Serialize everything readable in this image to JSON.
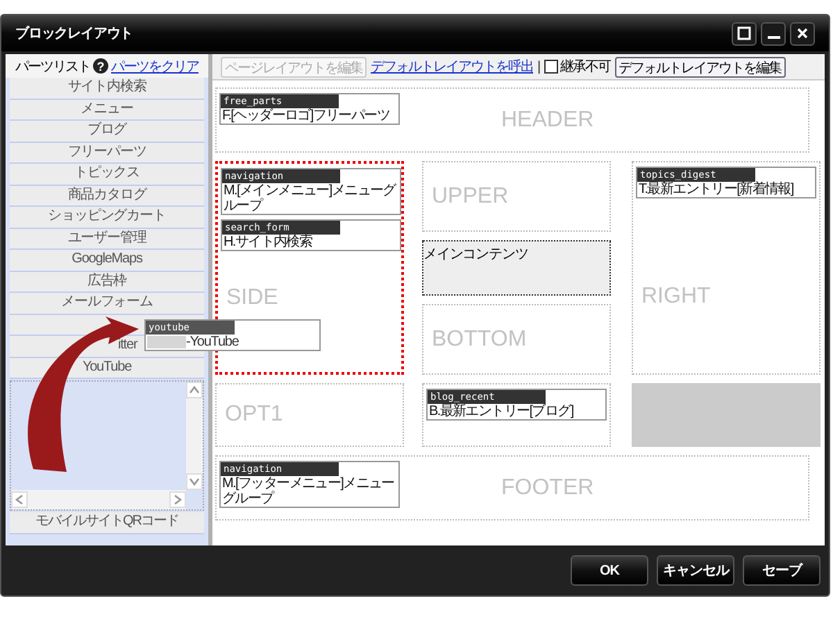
{
  "window": {
    "title": "ブロックレイアウト"
  },
  "title_buttons": [
    {
      "kind": "maximize"
    },
    {
      "kind": "minimize"
    },
    {
      "kind": "close"
    }
  ],
  "sidebar": {
    "title": "パーツリスト",
    "help": "?",
    "clear_link": "パーツをクリア",
    "items": [
      {
        "kind": "part",
        "label": "サイト内検索"
      },
      {
        "kind": "part",
        "label": "メニュー"
      },
      {
        "kind": "part",
        "label": "ブログ"
      },
      {
        "kind": "part",
        "label": "フリーパーツ"
      },
      {
        "kind": "part",
        "label": "トピックス"
      },
      {
        "kind": "part",
        "label": "商品カタログ"
      },
      {
        "kind": "part",
        "label": "ショッピングカート"
      },
      {
        "kind": "part",
        "label": "ユーザー管理"
      },
      {
        "kind": "part",
        "label": "GoogleMaps"
      },
      {
        "kind": "part",
        "label": "広告枠"
      },
      {
        "kind": "part",
        "label": "メールフォーム"
      },
      {
        "kind": "covered"
      },
      {
        "kind": "partial",
        "label": "itter"
      },
      {
        "kind": "part",
        "label": "YouTube"
      }
    ],
    "footer_item": "モバイルサイトQRコード"
  },
  "toolbar": {
    "edit_page_button": {
      "label": "ページレイアウトを編集",
      "disabled": true
    },
    "load_default_link": "デフォルトレイアウトを呼出",
    "separator": "|",
    "inherit_checkbox": {
      "label": "継承不可",
      "checked": false
    },
    "edit_default_button": {
      "label": "デフォルトレイアウトを編集",
      "disabled": false
    }
  },
  "regions": [
    {
      "kind": "header",
      "label": "HEADER",
      "selected": false,
      "parts": [
        {
          "name": "free_parts",
          "title": "F.[ヘッダーロゴ]フリーパーツ"
        }
      ]
    },
    {
      "kind": "side",
      "label": "SIDE",
      "selected": true,
      "parts": [
        {
          "name": "navigation",
          "title": "M.[メインメニュー]メニューグループ"
        },
        {
          "name": "search_form",
          "title": "H.サイト内検索"
        }
      ]
    },
    {
      "kind": "upper",
      "label": "UPPER",
      "selected": false
    },
    {
      "kind": "main",
      "label": "メインコンテンツ",
      "selected": false
    },
    {
      "kind": "bottom",
      "label": "BOTTOM",
      "selected": false
    },
    {
      "kind": "right",
      "label": "RIGHT",
      "selected": false,
      "parts": [
        {
          "name": "topics_digest",
          "title": "T.最新エントリー[新着情報]"
        }
      ]
    },
    {
      "kind": "opt1",
      "label": "OPT1",
      "selected": false
    },
    {
      "kind": "slot",
      "selected": false,
      "parts": [
        {
          "name": "blog_recent",
          "title": "B.最新エントリー[ブログ]"
        }
      ]
    },
    {
      "kind": "filled",
      "selected": false
    },
    {
      "kind": "footer",
      "label": "FOOTER",
      "selected": false,
      "parts": [
        {
          "name": "navigation",
          "title": "M.[フッターメニュー]メニューグループ"
        }
      ]
    }
  ],
  "drag_ghost": {
    "name": "youtube",
    "title": "-YouTube"
  },
  "buttons": [
    "OK",
    "キャンセル",
    "セーブ"
  ]
}
